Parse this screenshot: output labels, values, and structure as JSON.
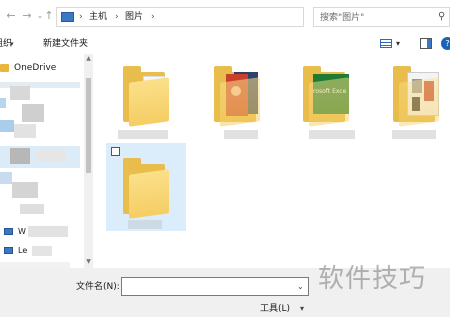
{
  "address_bar": {
    "breadcrumbs": [
      "主机",
      "图片"
    ],
    "separator": "›"
  },
  "search": {
    "placeholder": "搜索\"图片\""
  },
  "toolbar": {
    "organize_label": "组织",
    "new_folder_label": "新建文件夹"
  },
  "nav_pane": {
    "items": [
      {
        "label": "OneDrive",
        "icon": "onedrive-folder-icon"
      },
      {
        "label": "W",
        "icon": "pc-icon"
      },
      {
        "label": "Le",
        "icon": "pc-icon"
      }
    ]
  },
  "folders": [
    {
      "name": "folder-1",
      "preview": "documents"
    },
    {
      "name": "folder-2",
      "preview": "red-cover"
    },
    {
      "name": "folder-3",
      "preview": "excel",
      "preview_text": "rosoft Exce"
    },
    {
      "name": "folder-4",
      "preview": "magazine"
    },
    {
      "name": "folder-5",
      "preview": "empty"
    }
  ],
  "filename": {
    "label": "文件名(N):",
    "value": ""
  },
  "tools": {
    "label": "工具(L)"
  },
  "watermark": {
    "text": "软件技巧"
  },
  "colors": {
    "folder_yellow": "#e9bd4c",
    "selection_blue": "#dbecfb",
    "excel_green": "#1e7b34",
    "red_cover": "#c9412b"
  }
}
